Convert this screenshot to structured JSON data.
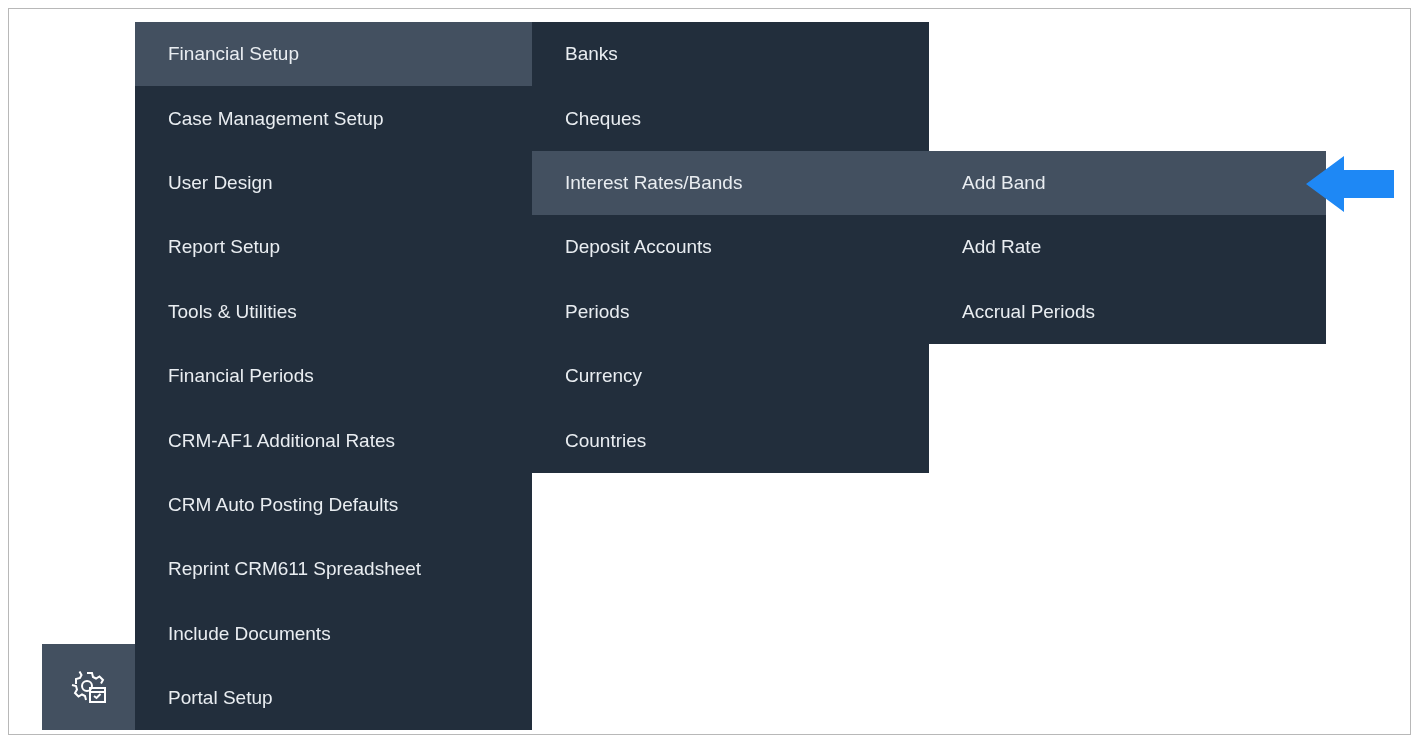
{
  "menu": {
    "items": [
      {
        "label": "Financial Setup",
        "selected": true,
        "children": [
          {
            "label": "Banks",
            "selected": false
          },
          {
            "label": "Cheques",
            "selected": false
          },
          {
            "label": "Interest Rates/Bands",
            "selected": true,
            "children": [
              {
                "label": "Add Band",
                "selected": true
              },
              {
                "label": "Add Rate",
                "selected": false
              },
              {
                "label": "Accrual Periods",
                "selected": false
              }
            ]
          },
          {
            "label": "Deposit Accounts",
            "selected": false
          },
          {
            "label": "Periods",
            "selected": false
          },
          {
            "label": "Currency",
            "selected": false
          },
          {
            "label": "Countries",
            "selected": false
          }
        ]
      },
      {
        "label": "Case Management Setup",
        "selected": false
      },
      {
        "label": "User Design",
        "selected": false
      },
      {
        "label": "Report Setup",
        "selected": false
      },
      {
        "label": "Tools & Utilities",
        "selected": false
      },
      {
        "label": "Financial Periods",
        "selected": false
      },
      {
        "label": "CRM-AF1 Additional Rates",
        "selected": false
      },
      {
        "label": "CRM Auto Posting Defaults",
        "selected": false
      },
      {
        "label": "Reprint CRM611 Spreadsheet",
        "selected": false
      },
      {
        "label": "Include Documents",
        "selected": false
      },
      {
        "label": "Portal Setup",
        "selected": false
      }
    ]
  }
}
